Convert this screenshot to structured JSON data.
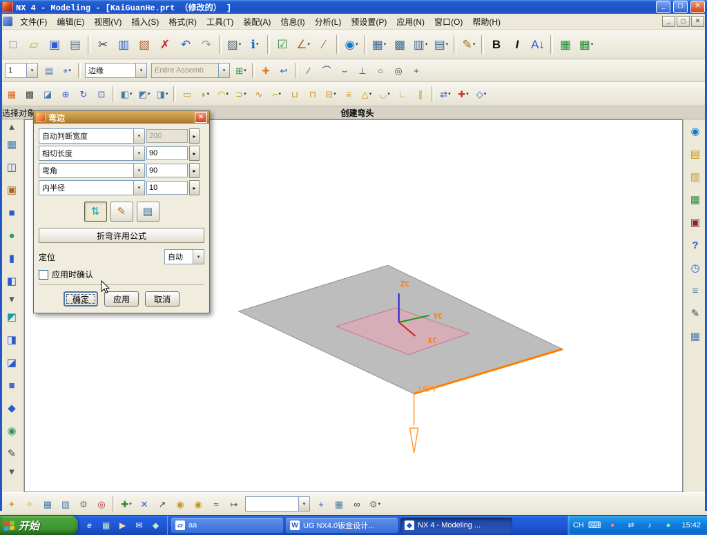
{
  "window": {
    "title": "NX 4 - Modeling - [KaiGuanHe.prt （修改的） ]",
    "min": "_",
    "restore": "◻",
    "close": "✕"
  },
  "menu": {
    "items": [
      "文件(F)",
      "编辑(E)",
      "视图(V)",
      "插入(S)",
      "格式(R)",
      "工具(T)",
      "装配(A)",
      "信息(I)",
      "分析(L)",
      "预设置(P)",
      "应用(N)",
      "窗口(O)",
      "帮助(H)"
    ]
  },
  "prompt": {
    "left": "选择对象",
    "center": "创建弯头"
  },
  "combos": {
    "layer": "1",
    "curve_rule": "边缘",
    "scope": "Entire Assemb",
    "bottom": ""
  },
  "dialog": {
    "title": "弯边",
    "close": "✕",
    "fields": [
      {
        "label": "自动判断宽度",
        "value": "200"
      },
      {
        "label": "相切长度",
        "value": "90"
      },
      {
        "label": "弯角",
        "value": "90"
      },
      {
        "label": "内半径",
        "value": "10"
      }
    ],
    "icon_buttons": [
      {
        "n": "bend-direction",
        "g": "⇅",
        "c": "#0a9ab0",
        "cls": "pressed"
      },
      {
        "n": "bend-face-select",
        "g": "✎",
        "c": "#a87020"
      },
      {
        "n": "bend-table",
        "g": "▤",
        "c": "#3a6a9a"
      }
    ],
    "formula_button": "折弯许用公式",
    "position_label": "定位",
    "position_value": "自动",
    "confirm_checkbox": "应用时确认",
    "ok": "确定",
    "apply": "应用",
    "cancel": "取消"
  },
  "viewport": {
    "zc": "ZC",
    "yc": "YC",
    "xc": "XC",
    "view": "LEFT"
  },
  "taskbar": {
    "start": "开始",
    "lang": "CH",
    "time": "15:42",
    "tasks": [
      {
        "label": "aa",
        "icon": "▱",
        "active": false
      },
      {
        "label": "UG NX4.0钣金设计...",
        "icon": "W",
        "active": false
      },
      {
        "label": "NX 4 - Modeling ...",
        "icon": "◆",
        "active": true
      }
    ]
  },
  "toolbars": {
    "standard": [
      {
        "n": "new-part",
        "g": "□",
        "c": "#6a7a9a"
      },
      {
        "n": "open",
        "g": "▱",
        "c": "#caa028"
      },
      {
        "n": "save",
        "g": "▣",
        "c": "#2a5ad0"
      },
      {
        "n": "print",
        "g": "▤",
        "c": "#6a7888"
      },
      {
        "sep": true
      },
      {
        "n": "cut",
        "g": "✂",
        "c": "#444455"
      },
      {
        "n": "copy",
        "g": "▥",
        "c": "#2a5ad0"
      },
      {
        "n": "paste",
        "g": "▧",
        "c": "#a8652a"
      },
      {
        "n": "delete",
        "g": "✗",
        "c": "#cc2222"
      },
      {
        "n": "undo",
        "g": "↶",
        "c": "#2a5ad0"
      },
      {
        "n": "redo",
        "g": "↷",
        "c": "#9a9a9a"
      },
      {
        "sep": true
      },
      {
        "n": "repeat-command",
        "g": "▨",
        "c": "#556677",
        "dd": true
      },
      {
        "n": "information",
        "g": "ℹ",
        "c": "#0a6ad0",
        "dd": true
      },
      {
        "sep": true
      },
      {
        "n": "task-checklist",
        "g": "☑",
        "c": "#2a8a3a"
      },
      {
        "n": "measure-distance",
        "g": "∠",
        "c": "#a87020",
        "dd": true
      },
      {
        "n": "measure-ruler",
        "g": "∕",
        "c": "#a87020"
      },
      {
        "sep": true
      },
      {
        "n": "web-browser",
        "g": "◉",
        "c": "#0a7ad0",
        "dd": true
      },
      {
        "sep": true
      },
      {
        "n": "layer-table",
        "g": "▦",
        "c": "#3a6a9a",
        "dd": true
      },
      {
        "n": "cell-format",
        "g": "▩",
        "c": "#3a6a9a"
      },
      {
        "n": "merge-cells",
        "g": "▥",
        "c": "#3a6a9a",
        "dd": true
      },
      {
        "n": "split-cells",
        "g": "▤",
        "c": "#3a6a9a",
        "dd": true
      },
      {
        "sep": true
      },
      {
        "n": "style-brush",
        "g": "✎",
        "c": "#a87020",
        "dd": true
      },
      {
        "sep": true
      },
      {
        "n": "bold",
        "g": "B",
        "c": "#111111",
        "cls": "bold"
      },
      {
        "n": "italic",
        "g": "I",
        "c": "#111111",
        "cls": "italic bold"
      },
      {
        "n": "sort-az",
        "g": "A↓",
        "c": "#2a5ad0"
      },
      {
        "sep": true
      },
      {
        "n": "spreadsheet",
        "g": "▦",
        "c": "#2a8a3a"
      },
      {
        "n": "export-table",
        "g": "▦",
        "c": "#2a8a3a",
        "dd": true
      }
    ],
    "row2a": [
      {
        "n": "layer-manager",
        "g": "▤",
        "c": "#4a7aa8"
      },
      {
        "n": "wcs-orient",
        "g": "⌖",
        "c": "#2a5ad0",
        "dd": true
      },
      {
        "sep": true
      }
    ],
    "row2b": [
      {
        "n": "add-to-assembly",
        "g": "⊞",
        "c": "#2a8a3a",
        "dd": true
      },
      {
        "sep": true
      },
      {
        "n": "move-object",
        "g": "✚",
        "c": "#e07818"
      },
      {
        "n": "return-arrow",
        "g": "↩",
        "c": "#2a5ad0"
      },
      {
        "sep": true
      },
      {
        "n": "snap-line",
        "g": "∕",
        "c": "#444455"
      },
      {
        "n": "snap-arc",
        "g": "⌒",
        "c": "#444455"
      },
      {
        "n": "snap-tangent",
        "g": "⌣",
        "c": "#444455"
      },
      {
        "n": "snap-perpendicular",
        "g": "⊥",
        "c": "#444455"
      },
      {
        "n": "snap-circle",
        "g": "○",
        "c": "#444455"
      },
      {
        "n": "snap-concentric",
        "g": "◎",
        "c": "#444455"
      },
      {
        "n": "snap-point",
        "g": "+",
        "c": "#444455"
      }
    ],
    "features": [
      {
        "n": "refresh-display",
        "g": "▦",
        "c": "#e06018"
      },
      {
        "n": "object-display",
        "g": "▩",
        "c": "#444444"
      },
      {
        "n": "show-hide",
        "g": "◪",
        "c": "#4a7aa8"
      },
      {
        "n": "zoom",
        "g": "⊕",
        "c": "#2a5ad0"
      },
      {
        "n": "regenerate",
        "g": "↻",
        "c": "#2a5ad0"
      },
      {
        "n": "fit-view",
        "g": "⊡",
        "c": "#2a5ad0"
      },
      {
        "sep": true
      },
      {
        "n": "orient-view",
        "g": "◧",
        "c": "#4a7aa8",
        "dd": true
      },
      {
        "n": "render-style",
        "g": "◩",
        "c": "#4a7aa8",
        "dd": true
      },
      {
        "n": "view-layout",
        "g": "◨",
        "c": "#4a7aa8",
        "dd": true
      },
      {
        "sep": true
      },
      {
        "n": "sm-tab",
        "g": "▭",
        "c": "#c8941c"
      },
      {
        "n": "sm-flange",
        "g": "◗",
        "c": "#c8941c",
        "dd": true
      },
      {
        "n": "sm-contour-flange",
        "g": "◠",
        "c": "#c8941c",
        "dd": true
      },
      {
        "n": "sm-hem",
        "g": "⊃",
        "c": "#c8941c",
        "dd": true
      },
      {
        "n": "sm-jog",
        "g": "∿",
        "c": "#c8941c"
      },
      {
        "n": "sm-bend",
        "g": "⌐",
        "c": "#c8941c",
        "dd": true
      },
      {
        "n": "sm-unbend",
        "g": "⊔",
        "c": "#c8941c"
      },
      {
        "n": "sm-rebend",
        "g": "⊓",
        "c": "#c8941c"
      },
      {
        "n": "sm-cutout",
        "g": "⊟",
        "c": "#c8941c",
        "dd": true
      },
      {
        "n": "sm-louver",
        "g": "≡",
        "c": "#c8941c"
      },
      {
        "n": "sm-dimple",
        "g": "△",
        "c": "#c8941c",
        "dd": true
      },
      {
        "n": "sm-bead",
        "g": "◡",
        "c": "#c8941c",
        "dd": true
      },
      {
        "n": "sm-corner",
        "g": "∟",
        "c": "#c8941c"
      },
      {
        "n": "sm-rip",
        "g": "∥",
        "c": "#c8941c"
      },
      {
        "sep": true
      },
      {
        "n": "sm-convert",
        "g": "⇄",
        "c": "#2a5ad0",
        "dd": true
      },
      {
        "n": "sm-feature-add",
        "g": "✚",
        "c": "#cc3333",
        "dd": true
      },
      {
        "n": "sm-misc",
        "g": "◇",
        "c": "#2a5ad0",
        "dd": true
      }
    ],
    "left_bar": [
      {
        "n": "scroll-up",
        "g": "▴",
        "c": "#555566",
        "cls": "small"
      },
      {
        "n": "palette",
        "g": "▦",
        "c": "#4a7aa8"
      },
      {
        "n": "wireframe-box",
        "g": "◫",
        "c": "#2a5ad0"
      },
      {
        "n": "sheet-part",
        "g": "▣",
        "c": "#a8652a"
      },
      {
        "n": "solid-cube",
        "g": "■",
        "c": "#2a5ad0"
      },
      {
        "n": "sphere-tool",
        "g": "●",
        "c": "#2a9a6a"
      },
      {
        "n": "cylinder-tool",
        "g": "▮",
        "c": "#2a5ad0"
      },
      {
        "n": "datum-tool",
        "g": "◧",
        "c": "#2a5ad0"
      },
      {
        "n": "mid-scroll",
        "g": "▾",
        "c": "#555566",
        "cls": "small"
      },
      {
        "n": "teal-feature",
        "g": "◩",
        "c": "#1a9aa8"
      },
      {
        "n": "blue-feature-a",
        "g": "◨",
        "c": "#2a5ad0"
      },
      {
        "n": "blue-feature-b",
        "g": "◪",
        "c": "#2a5ad0"
      },
      {
        "n": "blue-feature-c",
        "g": "■",
        "c": "#4a6ad0"
      },
      {
        "n": "diamond-feature",
        "g": "◆",
        "c": "#2a5ad0"
      },
      {
        "n": "user-tool",
        "g": "◉",
        "c": "#2a9a6a"
      },
      {
        "n": "annotate-tool",
        "g": "✎",
        "c": "#444455"
      },
      {
        "n": "scroll-down",
        "g": "▾",
        "c": "#555566",
        "cls": "small"
      }
    ],
    "right_bar": [
      {
        "n": "integrated-browser",
        "g": "◉",
        "c": "#0a7ad0"
      },
      {
        "n": "assembly-navigator",
        "g": "▤",
        "c": "#c8941c"
      },
      {
        "n": "constraint-navigator",
        "g": "▥",
        "c": "#c8941c"
      },
      {
        "n": "part-navigator",
        "g": "▦",
        "c": "#2a8a3a"
      },
      {
        "n": "roles",
        "g": "▣",
        "c": "#8a2222"
      },
      {
        "n": "help",
        "g": "?",
        "c": "#2a5ad0",
        "cls": "bold"
      },
      {
        "n": "history",
        "g": "◷",
        "c": "#2a5ad0"
      },
      {
        "n": "details-panel",
        "g": "≡",
        "c": "#4a7aa8"
      },
      {
        "n": "signature",
        "g": "✎",
        "c": "#444455"
      },
      {
        "n": "spreadsheet-panel",
        "g": "▦",
        "c": "#4a7aa8"
      }
    ],
    "bottom_left": [
      {
        "n": "snap-star",
        "g": "✦",
        "c": "#d8a018"
      },
      {
        "n": "snap-star-alt",
        "g": "✧",
        "c": "#d8a018"
      },
      {
        "n": "grid-a",
        "g": "▦",
        "c": "#4a7aa8"
      },
      {
        "n": "grid-b",
        "g": "▥",
        "c": "#4a7aa8"
      },
      {
        "n": "gears",
        "g": "⚙",
        "c": "#6a7888"
      },
      {
        "n": "selection-ball",
        "g": "◎",
        "c": "#b03030"
      },
      {
        "sep": true
      },
      {
        "n": "create-point",
        "g": "✚",
        "c": "#2a8a3a",
        "dd": true
      },
      {
        "n": "close-tool",
        "g": "✕",
        "c": "#2a5ad0"
      },
      {
        "n": "vector-tool",
        "g": "↗",
        "c": "#444455"
      },
      {
        "n": "coin-a",
        "g": "◉",
        "c": "#c8941c"
      },
      {
        "n": "coin-b",
        "g": "◉",
        "c": "#c8941c"
      },
      {
        "n": "wave-tool",
        "g": "≈",
        "c": "#2a5ad0"
      },
      {
        "n": "map-tool",
        "g": "↦",
        "c": "#444455"
      }
    ],
    "bottom_right": [
      {
        "n": "node-point",
        "g": "+",
        "c": "#2a5ad0"
      },
      {
        "n": "grid-snap",
        "g": "▦",
        "c": "#4a7aa8"
      },
      {
        "n": "link-objects",
        "g": "∞",
        "c": "#444455"
      },
      {
        "n": "gear-add",
        "g": "⚙",
        "c": "#6a7888",
        "dd": true
      }
    ],
    "quick_launch": [
      {
        "n": "launch-browser",
        "g": "e",
        "c": "#bfe0ff",
        "cls": "italic bold"
      },
      {
        "n": "show-desktop",
        "g": "▦",
        "c": "#cfe8cf"
      },
      {
        "n": "media-player",
        "g": "▶",
        "c": "#ffd9a8"
      },
      {
        "n": "mail",
        "g": "✉",
        "c": "#ffffff"
      },
      {
        "n": "messenger",
        "g": "◆",
        "c": "#baf0ba"
      }
    ],
    "tray_icons": [
      {
        "n": "antivirus",
        "g": "●",
        "c": "#ff7a7a"
      },
      {
        "n": "network",
        "g": "⇄",
        "c": "#d8ecff"
      },
      {
        "n": "volume",
        "g": "♪",
        "c": "#ffffff"
      },
      {
        "n": "update",
        "g": "●",
        "c": "#9af09a"
      }
    ]
  }
}
